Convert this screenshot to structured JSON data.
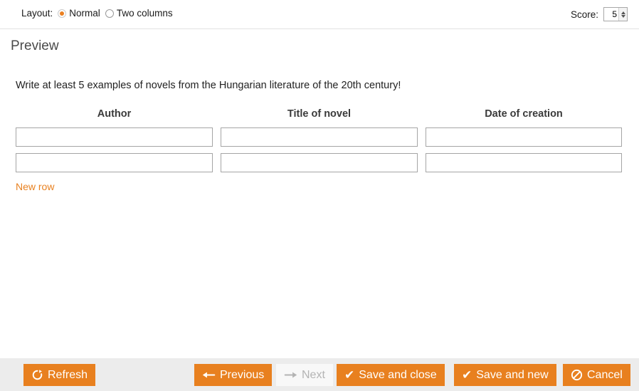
{
  "toolbar_top": {
    "layout_label": "Layout:",
    "options": [
      {
        "label": "Normal",
        "checked": true
      },
      {
        "label": "Two columns",
        "checked": false
      }
    ],
    "score_label": "Score:",
    "score_value": "5"
  },
  "preview": {
    "heading": "Preview",
    "question": "Write at least 5 examples of novels from the Hungarian literature of the 20th century!"
  },
  "table": {
    "headers": [
      "Author",
      "Title of novel",
      "Date of creation"
    ],
    "rows": [
      {
        "author": "",
        "title": "",
        "date": ""
      },
      {
        "author": "",
        "title": "",
        "date": ""
      }
    ],
    "new_row_label": "New row"
  },
  "footer": {
    "buttons": [
      {
        "label": "Refresh",
        "icon": "refresh-icon",
        "disabled": false
      },
      {
        "label": "Previous",
        "icon": "arrow-left-icon",
        "disabled": false
      },
      {
        "label": "Next",
        "icon": "arrow-right-icon",
        "disabled": true
      },
      {
        "label": "Save and close",
        "icon": "check-icon",
        "disabled": false
      },
      {
        "label": "Save and new",
        "icon": "check-icon",
        "disabled": false
      },
      {
        "label": "Cancel",
        "icon": "prohibition-icon",
        "disabled": false
      }
    ]
  },
  "colors": {
    "accent": "#e8801f",
    "footer_bg": "#ececec",
    "disabled_bg": "#f8f8f8",
    "disabled_fg": "#b4b4b4",
    "input_border": "#a5a5a5",
    "heading_fg": "#4a4a4a"
  }
}
